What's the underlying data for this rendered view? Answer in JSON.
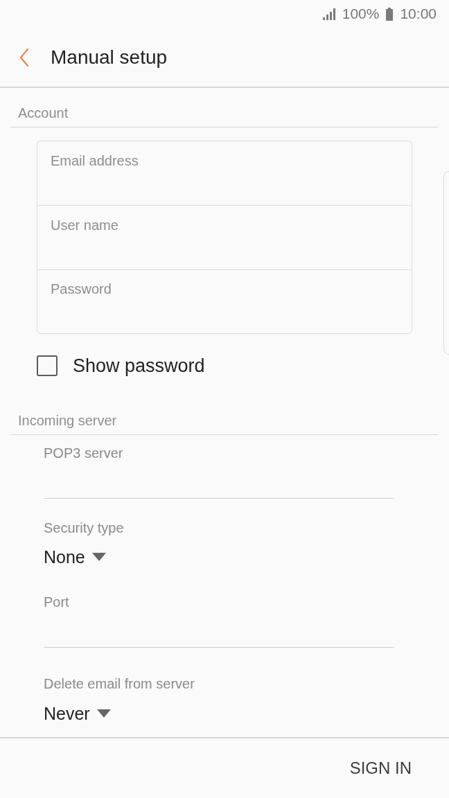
{
  "status_bar": {
    "battery": "100%",
    "time": "10:00"
  },
  "header": {
    "title": "Manual setup"
  },
  "account": {
    "title": "Account",
    "fields": [
      {
        "placeholder": "Email address"
      },
      {
        "placeholder": "User name"
      },
      {
        "placeholder": "Password"
      }
    ],
    "show_password": {
      "label": "Show password",
      "checked": false
    }
  },
  "incoming_server": {
    "title": "Incoming server",
    "fields": [
      {
        "kind": "text",
        "label": "POP3 server"
      },
      {
        "kind": "dropdown",
        "label": "Security type",
        "value": "None"
      },
      {
        "kind": "text",
        "label": "Port"
      },
      {
        "kind": "dropdown",
        "label": "Delete email from server",
        "value": "Never"
      }
    ]
  },
  "footer": {
    "button": "SIGN IN"
  }
}
